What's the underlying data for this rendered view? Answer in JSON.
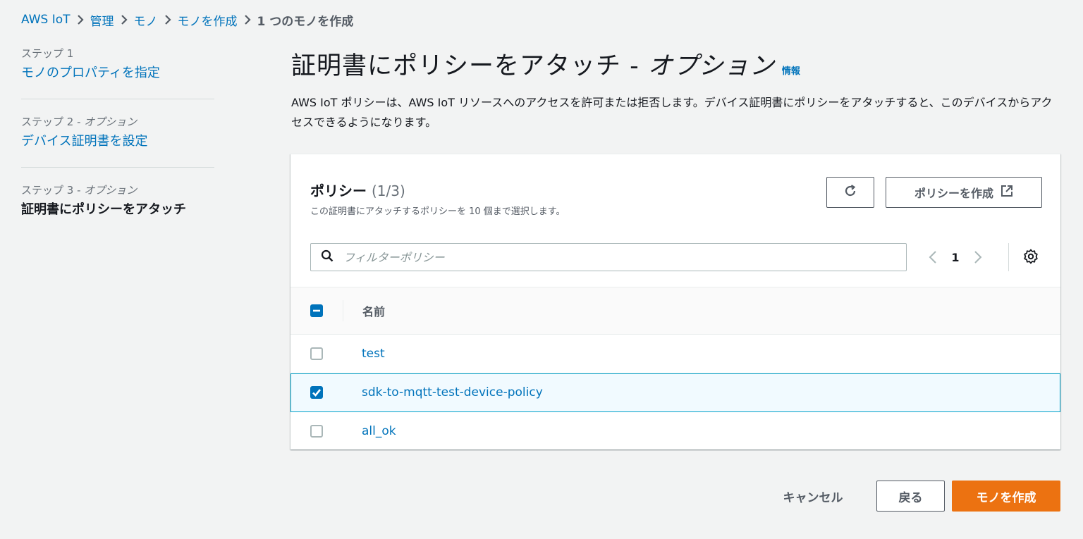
{
  "breadcrumb": {
    "items": [
      "AWS IoT",
      "管理",
      "モノ",
      "モノを作成"
    ],
    "current": "1 つのモノを作成"
  },
  "steps": [
    {
      "label": "ステップ 1",
      "option": "",
      "title": "モノのプロパティを指定"
    },
    {
      "label": "ステップ 2 - ",
      "option": "オプション",
      "title": "デバイス証明書を設定"
    },
    {
      "label": "ステップ 3 - ",
      "option": "オプション",
      "title": "証明書にポリシーをアタッチ"
    }
  ],
  "header": {
    "title_main": "証明書にポリシーをアタッチ - ",
    "title_option": "オプション",
    "info": "情報",
    "description": "AWS IoT ポリシーは、AWS IoT リソースへのアクセスを許可または拒否します。デバイス証明書にポリシーをアタッチすると、このデバイスからアクセスできるようになります。"
  },
  "policies": {
    "title": "ポリシー",
    "count": "(1/3)",
    "description": "この証明書にアタッチするポリシーを 10 個まで選択します。",
    "create_button": "ポリシーを作成",
    "filter_placeholder": "フィルターポリシー",
    "page": "1",
    "column_name": "名前",
    "rows": [
      {
        "name": "test",
        "selected": false
      },
      {
        "name": "sdk-to-mqtt-test-device-policy",
        "selected": true
      },
      {
        "name": "all_ok",
        "selected": false
      }
    ]
  },
  "footer": {
    "cancel": "キャンセル",
    "back": "戻る",
    "create": "モノを作成"
  },
  "colors": {
    "link": "#0073bb",
    "primary_button": "#ec7211",
    "selected_row_bg": "#f1faff",
    "selected_row_border": "#00a1c9"
  }
}
